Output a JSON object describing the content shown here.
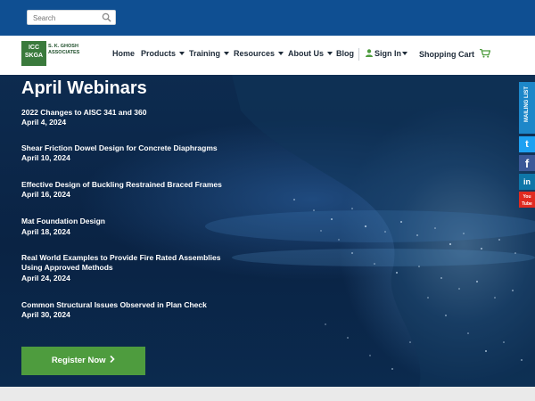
{
  "search": {
    "placeholder": "Search",
    "icon": "search-icon"
  },
  "logo": {
    "badge_line1": "ICC",
    "badge_line2": "SKGA",
    "name_line1": "S. K. GHOSH",
    "name_line2": "ASSOCIATES"
  },
  "nav": {
    "home": "Home",
    "products": "Products",
    "training": "Training",
    "resources": "Resources",
    "about": "About Us",
    "blog": "Blog",
    "sign_in": "Sign In",
    "cart": "Shopping Cart"
  },
  "hero": {
    "title": "April Webinars",
    "webinars": [
      {
        "title": "2022 Changes to AISC 341 and 360",
        "date": "April 4, 2024"
      },
      {
        "title": "Shear Friction Dowel Design for Concrete Diaphragms",
        "date": "April 10, 2024"
      },
      {
        "title": "Effective Design of Buckling Restrained Braced Frames",
        "date": "April 16, 2024"
      },
      {
        "title": "Mat Foundation Design",
        "date": "April 18, 2024"
      },
      {
        "title": "Real World Examples to Provide Fire Rated Assemblies Using Approved Methods",
        "date": "April 24, 2024"
      },
      {
        "title": "Common Structural Issues Observed in Plan Check",
        "date": "April 30, 2024"
      }
    ],
    "register": "Register Now"
  },
  "side": {
    "mailing": "MAILING LIST",
    "twitter": "t",
    "facebook": "f",
    "linkedin": "in",
    "youtube": "You Tube"
  },
  "colors": {
    "topbar": "#0f4f92",
    "register": "#4e9c3e",
    "mailing": "#1d87c9",
    "twitter": "#1da1f2",
    "facebook": "#3b5998",
    "linkedin": "#0e76a8",
    "youtube": "#e02a20"
  }
}
